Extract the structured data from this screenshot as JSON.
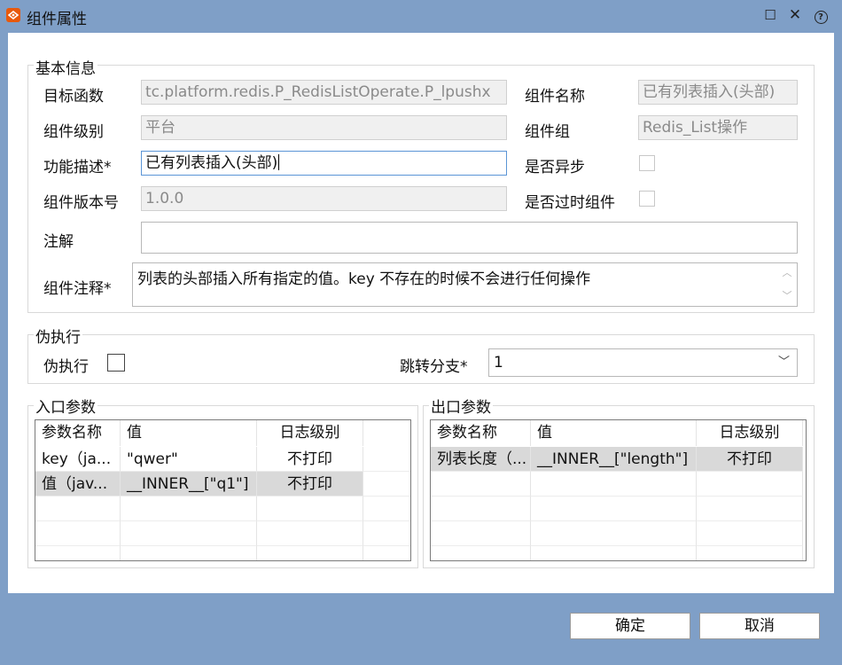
{
  "window": {
    "title": "组件属性",
    "icons": {
      "app": "app-logo-icon",
      "minimize": "maximize-icon",
      "close": "close-icon",
      "help": "help-icon"
    },
    "minimize_glyph": "☐",
    "close_glyph": "✕",
    "help_glyph": "?"
  },
  "basic": {
    "group_title": "基本信息",
    "target_fn_label": "目标函数",
    "target_fn_value": "tc.platform.redis.P_RedisListOperate.P_lpushx",
    "comp_name_label": "组件名称",
    "comp_name_value": "已有列表插入(头部)",
    "comp_level_label": "组件级别",
    "comp_level_value": "平台",
    "comp_group_label": "组件组",
    "comp_group_value": "Redis_List操作",
    "func_desc_label": "功能描述*",
    "func_desc_value": "已有列表插入(头部)",
    "async_label": "是否异步",
    "async_checked": false,
    "version_label": "组件版本号",
    "version_value": "1.0.0",
    "deprecated_label": "是否过时组件",
    "deprecated_checked": false,
    "note_label": "注解",
    "note_value": "",
    "comment_label": "组件注释*",
    "comment_value": "列表的头部插入所有指定的值。key 不存在的时候不会进行任何操作"
  },
  "pseudo": {
    "group_title": "伪执行",
    "exec_label": "伪执行",
    "exec_checked": false,
    "branch_label": "跳转分支*",
    "branch_value": "1"
  },
  "input_params": {
    "group_title": "入口参数",
    "headers": [
      "参数名称",
      "值",
      "日志级别"
    ],
    "rows": [
      {
        "name": "key（ja...",
        "value": "\"qwer\"",
        "level": "不打印",
        "selected": false
      },
      {
        "name": "值（jav...",
        "value": "__INNER__[\"q1\"]",
        "level": "不打印",
        "selected": true
      }
    ]
  },
  "output_params": {
    "group_title": "出口参数",
    "headers": [
      "参数名称",
      "值",
      "日志级别"
    ],
    "rows": [
      {
        "name": "列表长度（...",
        "value": "__INNER__[\"length\"]",
        "level": "不打印",
        "selected": true
      }
    ]
  },
  "footer": {
    "ok_label": "确定",
    "cancel_label": "取消"
  }
}
